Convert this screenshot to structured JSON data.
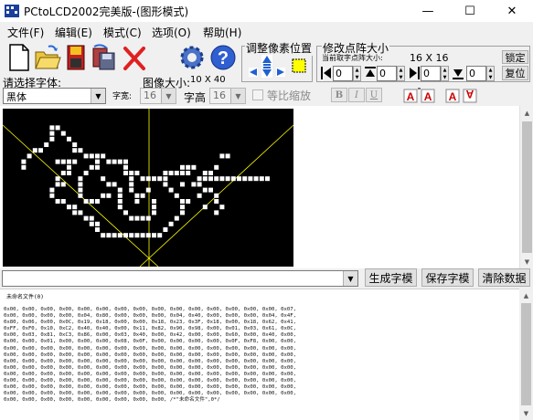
{
  "window": {
    "title": "PCtoLCD2002完美版-(图形模式)",
    "controls": [
      "—",
      "☐",
      "✕"
    ]
  },
  "menu": [
    {
      "label": "文件(F)"
    },
    {
      "label": "编辑(E)"
    },
    {
      "label": "模式(C)"
    },
    {
      "label": "选项(O)"
    },
    {
      "label": "帮助(H)"
    }
  ],
  "toolbar": {
    "adjust_group_label": "调整像素位置",
    "resize_group_label": "修改点阵大小",
    "current_size_label": "当前取字点阵大小:",
    "current_size_value": "16 X 16",
    "lock_button": "锁定",
    "restore_button": "复位",
    "shift_values": [
      "0",
      "0",
      "0",
      "0"
    ]
  },
  "font_row": {
    "select_font_label": "请选择字体:",
    "font_value": "黑体",
    "char_width_label": "字宽:",
    "char_width_value": "16",
    "image_size_label": "图像大小:",
    "image_size_value": "10 X 40",
    "char_height_label": "字高",
    "char_height_value": "16",
    "proportional_label": "等比缩放",
    "bold_label": "B",
    "italic_label": "I",
    "underline_label": "U"
  },
  "actions": {
    "generate_button": "生成字模",
    "save_button": "保存字模",
    "clear_button": "清除数据"
  },
  "output": {
    "header": "未命名文件(0)",
    "lines": [
      "0x00, 0x00, 0x00, 0x00, 0x00, 0x00, 0x00, 0x00, 0x00, 0x00, 0x00, 0x00, 0x00, 0x00, 0x00, 0x07,",
      "0x00, 0x00, 0x00, 0x00, 0x04, 0x80, 0x00, 0x00, 0x00, 0x04, 0x40, 0x00, 0x00, 0x00, 0x04, 0x4F,",
      "0x80, 0x06, 0x00, 0x0C, 0x19, 0x18, 0x00, 0x00, 0x18, 0x23, 0x3F, 0x18, 0x00, 0x18, 0x62, 0x41,",
      "0xFF, 0xF0, 0x10, 0xC2, 0x40, 0x40, 0x00, 0x11, 0x82, 0x90, 0x98, 0x00, 0x01, 0x03, 0x61, 0x0C,",
      "0x00, 0x03, 0x81, 0xC3, 0x86, 0x00, 0x03, 0x40, 0x00, 0x42, 0x00, 0x00, 0x60, 0x00, 0x40, 0x00,",
      "0x00, 0x00, 0x01, 0x00, 0x00, 0x00, 0x08, 0x0F, 0x00, 0x00, 0x00, 0x00, 0x0F, 0xF8, 0x00, 0x00,",
      "0x00, 0x00, 0x00, 0x00, 0x00, 0x00, 0x00, 0x00, 0x00, 0x00, 0x00, 0x00, 0x00, 0x00, 0x00, 0x00,",
      "0x00, 0x00, 0x00, 0x00, 0x00, 0x00, 0x00, 0x00, 0x00, 0x00, 0x00, 0x00, 0x00, 0x00, 0x00, 0x00,",
      "0x00, 0x00, 0x00, 0x00, 0x00, 0x00, 0x00, 0x00, 0x00, 0x00, 0x00, 0x00, 0x00, 0x00, 0x00, 0x00,",
      "0x00, 0x00, 0x00, 0x00, 0x00, 0x00, 0x00, 0x00, 0x00, 0x00, 0x00, 0x00, 0x00, 0x00, 0x00, 0x00,",
      "0x00, 0x00, 0x00, 0x00, 0x00, 0x00, 0x00, 0x00, 0x00, 0x00, 0x00, 0x00, 0x00, 0x00, 0x00, 0x00,",
      "0x00, 0x00, 0x00, 0x00, 0x00, 0x00, 0x00, 0x00, 0x00, 0x00, 0x00, 0x00, 0x00, 0x00, 0x00, 0x00,",
      "0x00, 0x00, 0x00, 0x00, 0x00, 0x00, 0x00, 0x00, 0x00, 0x00, 0x00, 0x00, 0x00, 0x00, 0x00, 0x00,",
      "0x00, 0x00, 0x00, 0x00, 0x00, 0x00, 0x00, 0x00, 0x00, 0x00, 0x00, 0x00, 0x00, 0x00, 0x00, 0x00,",
      "0x00, 0x00, 0x00, 0x00, 0x00, 0x00, 0x00, 0x00, 0x00, /*\"未命名文件\",0*/"
    ]
  },
  "colors": {
    "lcd_background": "#000000",
    "pixel_on": "#ffffff",
    "guide_line": "#ffff00",
    "window_bg": "#f0f0f0"
  },
  "icons": [
    "new-file-icon",
    "open-folder-icon",
    "save-icon",
    "save-all-icon",
    "delete-icon",
    "settings-gear-icon",
    "help-icon"
  ]
}
